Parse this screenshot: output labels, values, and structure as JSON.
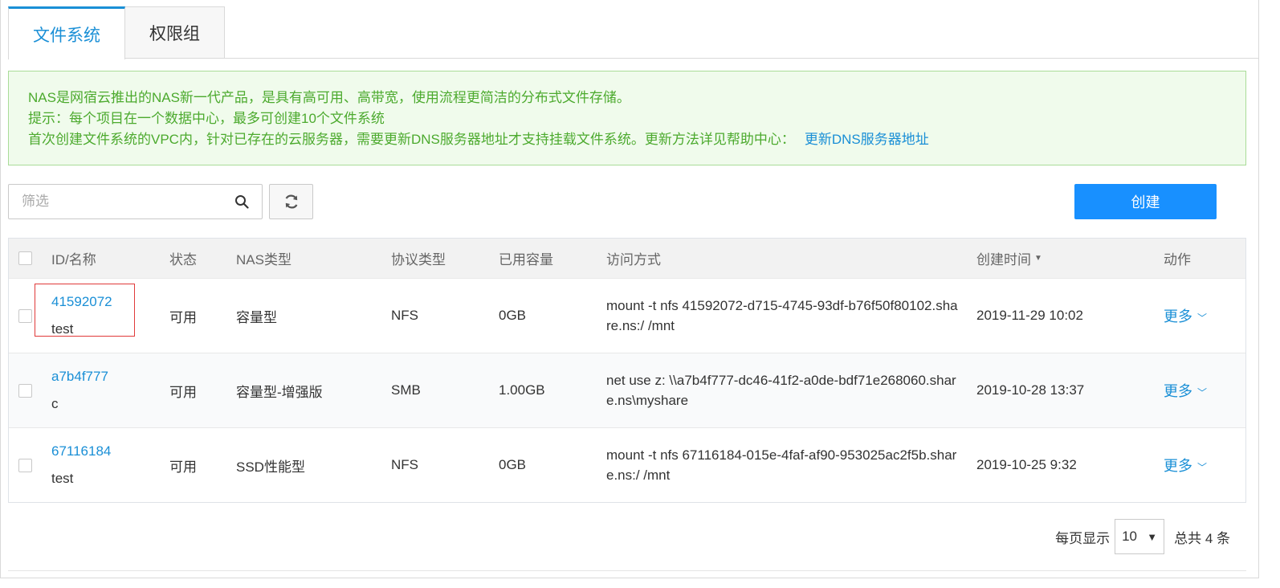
{
  "tabs": [
    {
      "label": "文件系统",
      "active": true
    },
    {
      "label": "权限组",
      "active": false
    }
  ],
  "notice": {
    "line1": "NAS是网宿云推出的NAS新一代产品，是具有高可用、高带宽，使用流程更简洁的分布式文件存储。",
    "line2": "提示：每个项目在一个数据中心，最多可创建10个文件系统",
    "line3": "首次创建文件系统的VPC内，针对已存在的云服务器，需要更新DNS服务器地址才支持挂载文件系统。更新方法详见帮助中心：",
    "link": "更新DNS服务器地址"
  },
  "toolbar": {
    "search_placeholder": "筛选",
    "create_label": "创建"
  },
  "table": {
    "headers": {
      "id_name": "ID/名称",
      "status": "状态",
      "nas_type": "NAS类型",
      "protocol": "协议类型",
      "used": "已用容量",
      "access": "访问方式",
      "created": "创建时间",
      "action": "动作"
    },
    "rows": [
      {
        "id": "41592072",
        "name": "test",
        "status": "可用",
        "nas_type": "容量型",
        "protocol": "NFS",
        "used": "0GB",
        "access": "mount -t nfs 41592072-d715-4745-93df-b76f50f80102.share.ns:/ /mnt",
        "created": "2019-11-29 10:02",
        "action": "更多"
      },
      {
        "id": "a7b4f777",
        "name": "c",
        "status": "可用",
        "nas_type": "容量型-增强版",
        "protocol": "SMB",
        "used": "1.00GB",
        "access": "net use z: \\\\a7b4f777-dc46-41f2-a0de-bdf71e268060.share.ns\\myshare",
        "created": "2019-10-28 13:37",
        "action": "更多"
      },
      {
        "id": "67116184",
        "name": "test",
        "status": "可用",
        "nas_type": "SSD性能型",
        "protocol": "NFS",
        "used": "0GB",
        "access": "mount -t nfs 67116184-015e-4faf-af90-953025ac2f5b.share.ns:/ /mnt",
        "created": "2019-10-25 9:32",
        "action": "更多"
      }
    ]
  },
  "pager": {
    "per_page_label": "每页显示",
    "per_page_value": "10",
    "total_label": "总共 4 条"
  },
  "colors": {
    "accent": "#1890ff",
    "link": "#1a8fd6",
    "notice_text": "#4caa2e",
    "notice_bg": "#f0fbec",
    "highlight": "#e03a3a"
  }
}
